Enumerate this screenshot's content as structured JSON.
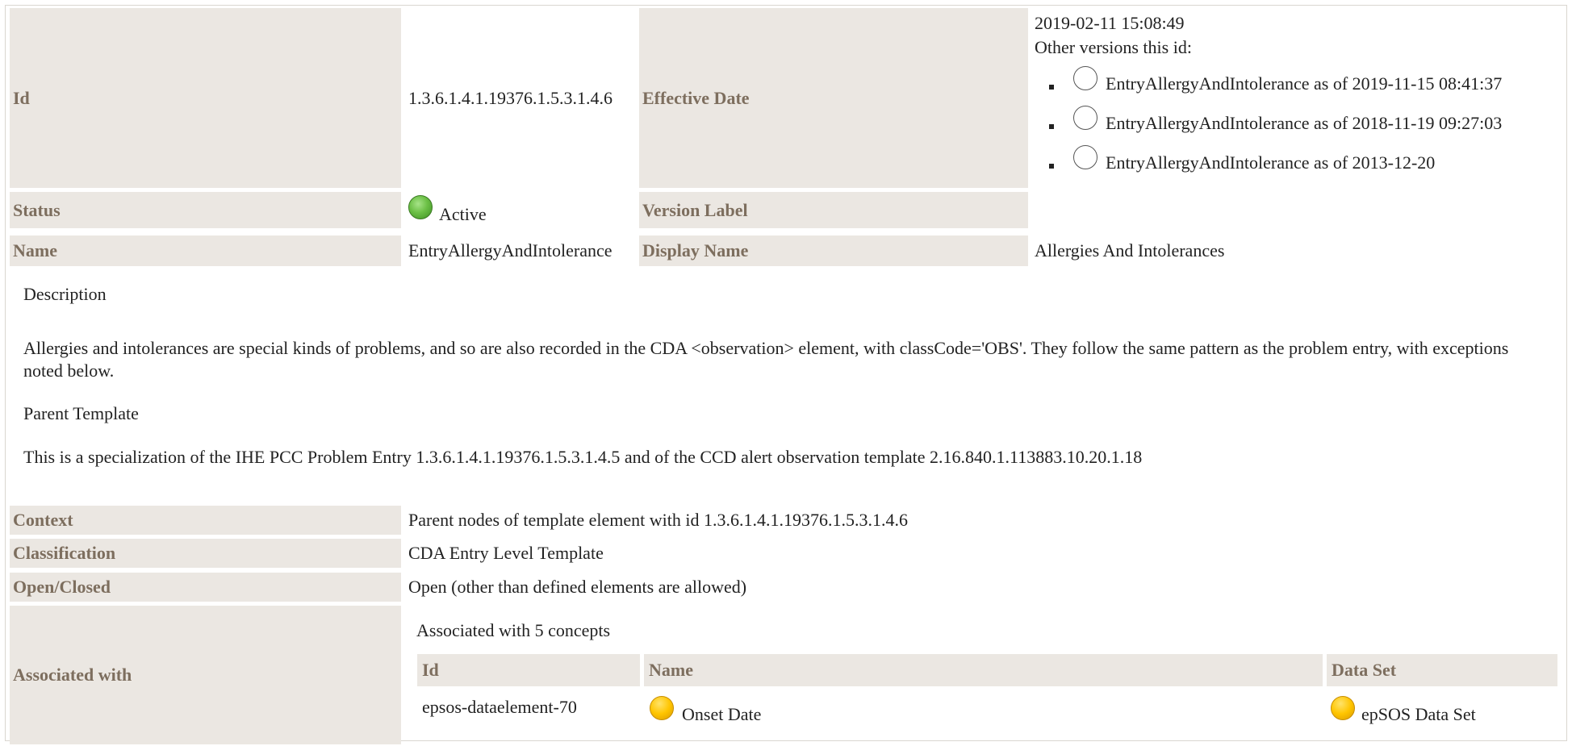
{
  "header": {
    "id_label": "Id",
    "id_value": "1.3.6.1.4.1.19376.1.5.3.1.4.6",
    "effective_date_label": "Effective Date",
    "effective_date_value": "2019-02-11 15:08:49",
    "other_versions_label": "Other versions this id:",
    "other_versions": [
      "EntryAllergyAndIntolerance as of 2019-11-15 08:41:37",
      "EntryAllergyAndIntolerance as of 2018-11-19 09:27:03",
      "EntryAllergyAndIntolerance as of 2013-12-20"
    ],
    "status_label": "Status",
    "status_value": "Active",
    "version_label_label": "Version Label",
    "name_label": "Name",
    "name_value": "EntryAllergyAndIntolerance",
    "display_name_label": "Display Name",
    "display_name_value": "Allergies And Intolerances"
  },
  "description": {
    "heading": "Description",
    "text": "Allergies and intolerances are special kinds of problems, and so are also recorded in the CDA <observation> element, with classCode='OBS'. They follow the same pattern as the problem entry, with exceptions noted below."
  },
  "parent_template": {
    "heading": "Parent Template",
    "text": "This is a specialization of the IHE PCC Problem Entry 1.3.6.1.4.1.19376.1.5.3.1.4.5 and of the CCD alert observation template 2.16.840.1.113883.10.20.1.18"
  },
  "properties": {
    "context_label": "Context",
    "context_value": "Parent nodes of template element with id 1.3.6.1.4.1.19376.1.5.3.1.4.6",
    "classification_label": "Classification",
    "classification_value": "CDA Entry Level Template",
    "open_closed_label": "Open/Closed",
    "open_closed_value": "Open (other than defined elements are allowed)",
    "associated_label": "Associated with",
    "associated_title": "Associated with 5 concepts"
  },
  "concepts_table": {
    "headers": [
      "Id",
      "Name",
      "Data Set"
    ],
    "rows": [
      {
        "id": "epsos-dataelement-70",
        "name": "Onset Date",
        "data_set": "epSOS Data Set"
      }
    ]
  },
  "colors": {
    "label_bg": "#ebe7e2",
    "label_text": "#7d6e5e",
    "status_active": "#6cc046",
    "concept_status": "#ffc500"
  },
  "icons": {
    "status": "green-status-ball-icon",
    "version_radio": "radio-circle-icon",
    "concept_status": "yellow-status-ball-icon"
  }
}
